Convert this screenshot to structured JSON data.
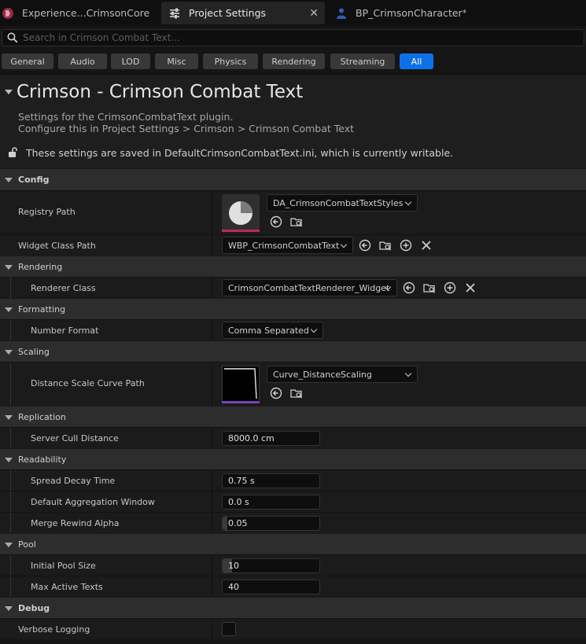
{
  "tabs": [
    {
      "label": "Experience...CrimsonCore",
      "icon": "unreal-logo-icon"
    },
    {
      "label": "Project Settings",
      "icon": "settings-sliders-icon"
    },
    {
      "label": "BP_CrimsonCharacter",
      "icon": "blueprint-character-icon"
    }
  ],
  "search": {
    "placeholder": "Search in Crimson Combat Text..."
  },
  "filters": [
    "General",
    "Audio",
    "LOD",
    "Misc",
    "Physics",
    "Rendering",
    "Streaming",
    "All"
  ],
  "header": {
    "title": "Crimson - Crimson Combat Text",
    "desc1": "Settings for the CrimsonCombatText plugin.",
    "desc2": "Configure this in Project Settings > Crimson > Crimson Combat Text",
    "info": "These settings are saved in DefaultCrimsonCombatText.ini, which is currently writable."
  },
  "sections": {
    "config": "Config",
    "rendering": "Rendering",
    "formatting": "Formatting",
    "scaling": "Scaling",
    "replication": "Replication",
    "readability": "Readability",
    "pool": "Pool",
    "debug": "Debug"
  },
  "props": {
    "registry_path": {
      "label": "Registry Path",
      "value": "DA_CrimsonCombatTextStyles"
    },
    "widget_class_path": {
      "label": "Widget Class Path",
      "value": "WBP_CrimsonCombatText"
    },
    "renderer_class": {
      "label": "Renderer Class",
      "value": "CrimsonCombatTextRenderer_Widget"
    },
    "number_format": {
      "label": "Number Format",
      "value": "Comma Separated"
    },
    "distance_scale_curve_path": {
      "label": "Distance Scale Curve Path",
      "value": "Curve_DistanceScaling"
    },
    "server_cull_distance": {
      "label": "Server Cull Distance",
      "value": "8000.0 cm"
    },
    "spread_decay_time": {
      "label": "Spread Decay Time",
      "value": "0.75 s"
    },
    "default_aggregation_window": {
      "label": "Default Aggregation Window",
      "value": "0.0 s"
    },
    "merge_rewind_alpha": {
      "label": "Merge Rewind Alpha",
      "value": "0.05",
      "fill": 0.05
    },
    "initial_pool_size": {
      "label": "Initial Pool Size",
      "value": "10",
      "fill": 0.1
    },
    "max_active_texts": {
      "label": "Max Active Texts",
      "value": "40"
    },
    "verbose_logging": {
      "label": "Verbose Logging",
      "checked": false
    }
  },
  "colors": {
    "accent": "#0e70e8",
    "asset_underline": "#c4245a",
    "curve_underline": "#7e3fc0"
  }
}
